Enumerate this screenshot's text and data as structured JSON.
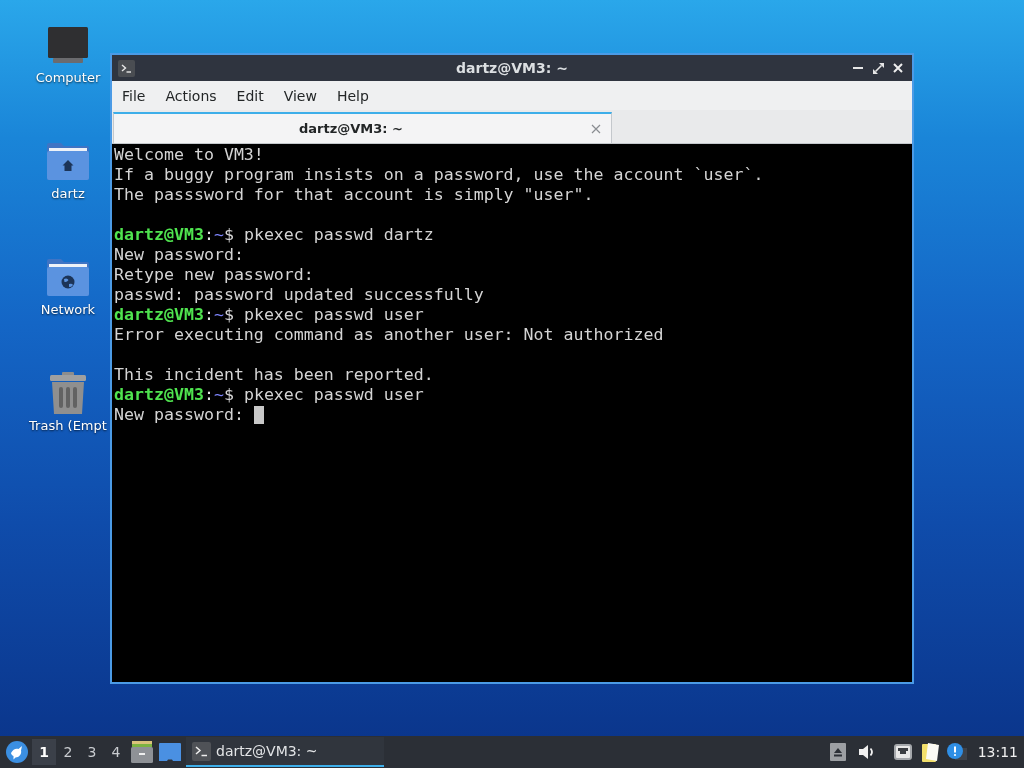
{
  "desktop_icons": [
    {
      "label": "Computer",
      "kind": "computer"
    },
    {
      "label": "dartz",
      "kind": "home"
    },
    {
      "label": "Network",
      "kind": "network"
    },
    {
      "label": "Trash (Empt",
      "kind": "trash"
    }
  ],
  "window": {
    "title": "dartz@VM3: ~",
    "menu": [
      "File",
      "Actions",
      "Edit",
      "View",
      "Help"
    ],
    "tabs": [
      {
        "label": "dartz@VM3: ~",
        "selected": true
      }
    ],
    "terminal": {
      "cursor": true,
      "lines": [
        {
          "kind": "output",
          "text": "Welcome to VM3!"
        },
        {
          "kind": "output",
          "text": "If a buggy program insists on a password, use the account `user`."
        },
        {
          "kind": "output",
          "text": "The passsword for that account is simply \"user\"."
        },
        {
          "kind": "blank"
        },
        {
          "kind": "prompt",
          "user_host": "dartz@VM3",
          "separator": ":",
          "path": "~",
          "symbol": "$",
          "command": "pkexec passwd dartz"
        },
        {
          "kind": "output",
          "text": "New password:"
        },
        {
          "kind": "output",
          "text": "Retype new password:"
        },
        {
          "kind": "output",
          "text": "passwd: password updated successfully"
        },
        {
          "kind": "prompt",
          "user_host": "dartz@VM3",
          "separator": ":",
          "path": "~",
          "symbol": "$",
          "command": "pkexec passwd user"
        },
        {
          "kind": "output",
          "text": "Error executing command as another user: Not authorized"
        },
        {
          "kind": "blank"
        },
        {
          "kind": "output",
          "text": "This incident has been reported."
        },
        {
          "kind": "prompt",
          "user_host": "dartz@VM3",
          "separator": ":",
          "path": "~",
          "symbol": "$",
          "command": "pkexec passwd user"
        },
        {
          "kind": "output",
          "text": "New password:"
        }
      ]
    }
  },
  "taskbar": {
    "workspaces": [
      {
        "label": "1",
        "selected": true
      },
      {
        "label": "2",
        "selected": false
      },
      {
        "label": "3",
        "selected": false
      },
      {
        "label": "4",
        "selected": false
      }
    ],
    "tasks": [
      {
        "label": "dartz@VM3: ~",
        "selected": true
      }
    ],
    "clock": "13:11"
  }
}
